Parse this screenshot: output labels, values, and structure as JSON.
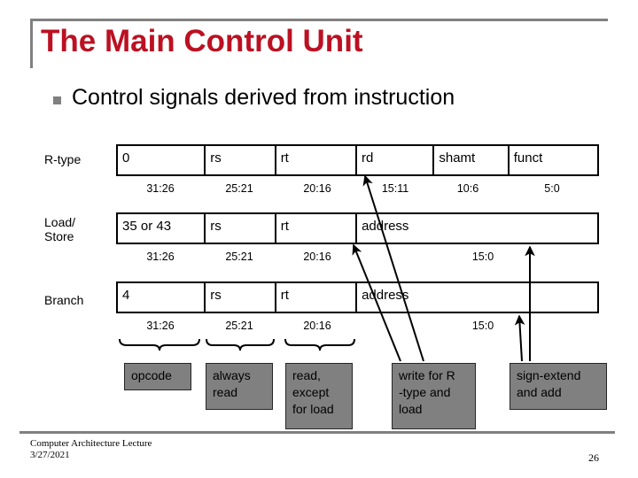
{
  "slide": {
    "title": "The Main Control Unit",
    "bullet": "Control signals derived from instruction",
    "accent_color": "#808080",
    "title_color": "#bb1122",
    "callout_fill": "#808080"
  },
  "formats": [
    {
      "label": "R-type",
      "cells": [
        "0",
        "rs",
        "rt",
        "rd",
        "shamt",
        "funct"
      ],
      "bits": [
        "31:26",
        "25:21",
        "20:16",
        "15:11",
        "10:6",
        "5:0"
      ]
    },
    {
      "label": "Load/\nStore",
      "cells": [
        "35 or 43",
        "rs",
        "rt",
        "address"
      ],
      "bits": [
        "31:26",
        "25:21",
        "20:16",
        "15:0"
      ]
    },
    {
      "label": "Branch",
      "cells": [
        "4",
        "rs",
        "rt",
        "address"
      ],
      "bits": [
        "31:26",
        "25:21",
        "20:16",
        "15:0"
      ]
    }
  ],
  "callouts": [
    {
      "text": "opcode"
    },
    {
      "text": "always\nread"
    },
    {
      "text": "read,\nexcept\nfor load"
    },
    {
      "text": "write for R\n-type and\nload"
    },
    {
      "text": "sign-extend\nand add"
    }
  ],
  "footer": {
    "line1": "Computer Architecture Lecture",
    "line2": "3/27/2021",
    "page_number": "26"
  }
}
